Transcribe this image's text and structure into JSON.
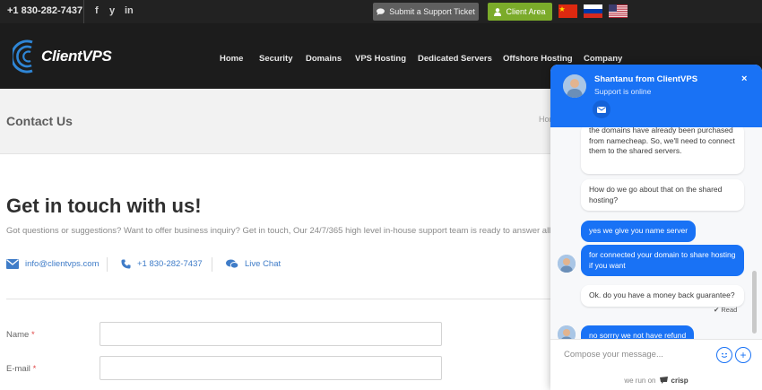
{
  "topbar": {
    "phone": "+1 830-282-7437",
    "social": [
      "f",
      "y",
      "in"
    ],
    "support_button": "Submit a Support Ticket",
    "client_button": "Client Area",
    "colors": {
      "support_bg": "#5f5f5f",
      "client_bg": "#7bab2a"
    }
  },
  "nav": {
    "logo": "ClientVPS",
    "items": [
      "Home",
      "Security",
      "Domains",
      "VPS Hosting",
      "Dedicated Servers",
      "Offshore Hosting",
      "Company"
    ]
  },
  "page": {
    "title": "Contact Us",
    "breadcrumb": "Hom"
  },
  "main": {
    "heading": "Get in touch with us!",
    "lead": "Got questions or suggestions? Want to offer business inquiry? Get in touch, Our 24/7/365 high level in-house support team is ready to answer all your q",
    "email": "info@clientvps.com",
    "phone": "+1 830-282-7437",
    "live_chat": "Live Chat",
    "form": {
      "name_label": "Name",
      "email_label": "E-mail",
      "required_mark": "*"
    }
  },
  "chat": {
    "agent": "Shantanu from ClientVPS",
    "status": "Support is online",
    "close": "×",
    "messages": [
      {
        "from": "visitor",
        "text": "the domains have already been purchased from namecheap. So, we'll need to connect them to the shared servers."
      },
      {
        "from": "visitor",
        "text": "How do we go about that on the shared hosting?"
      },
      {
        "from": "agent",
        "text": "yes we give you name server"
      },
      {
        "from": "agent",
        "text": "for connected your domain to share hosting if you want"
      },
      {
        "from": "visitor",
        "text": "Ok. do you have a money back guarantee?"
      },
      {
        "from": "agent",
        "text": "no sorrry we not have refund"
      }
    ],
    "read_receipt": "Read",
    "compose_placeholder": "Compose your message...",
    "powered_by_prefix": "we run on",
    "powered_by_brand": "crisp",
    "accent": "#1972f5"
  }
}
